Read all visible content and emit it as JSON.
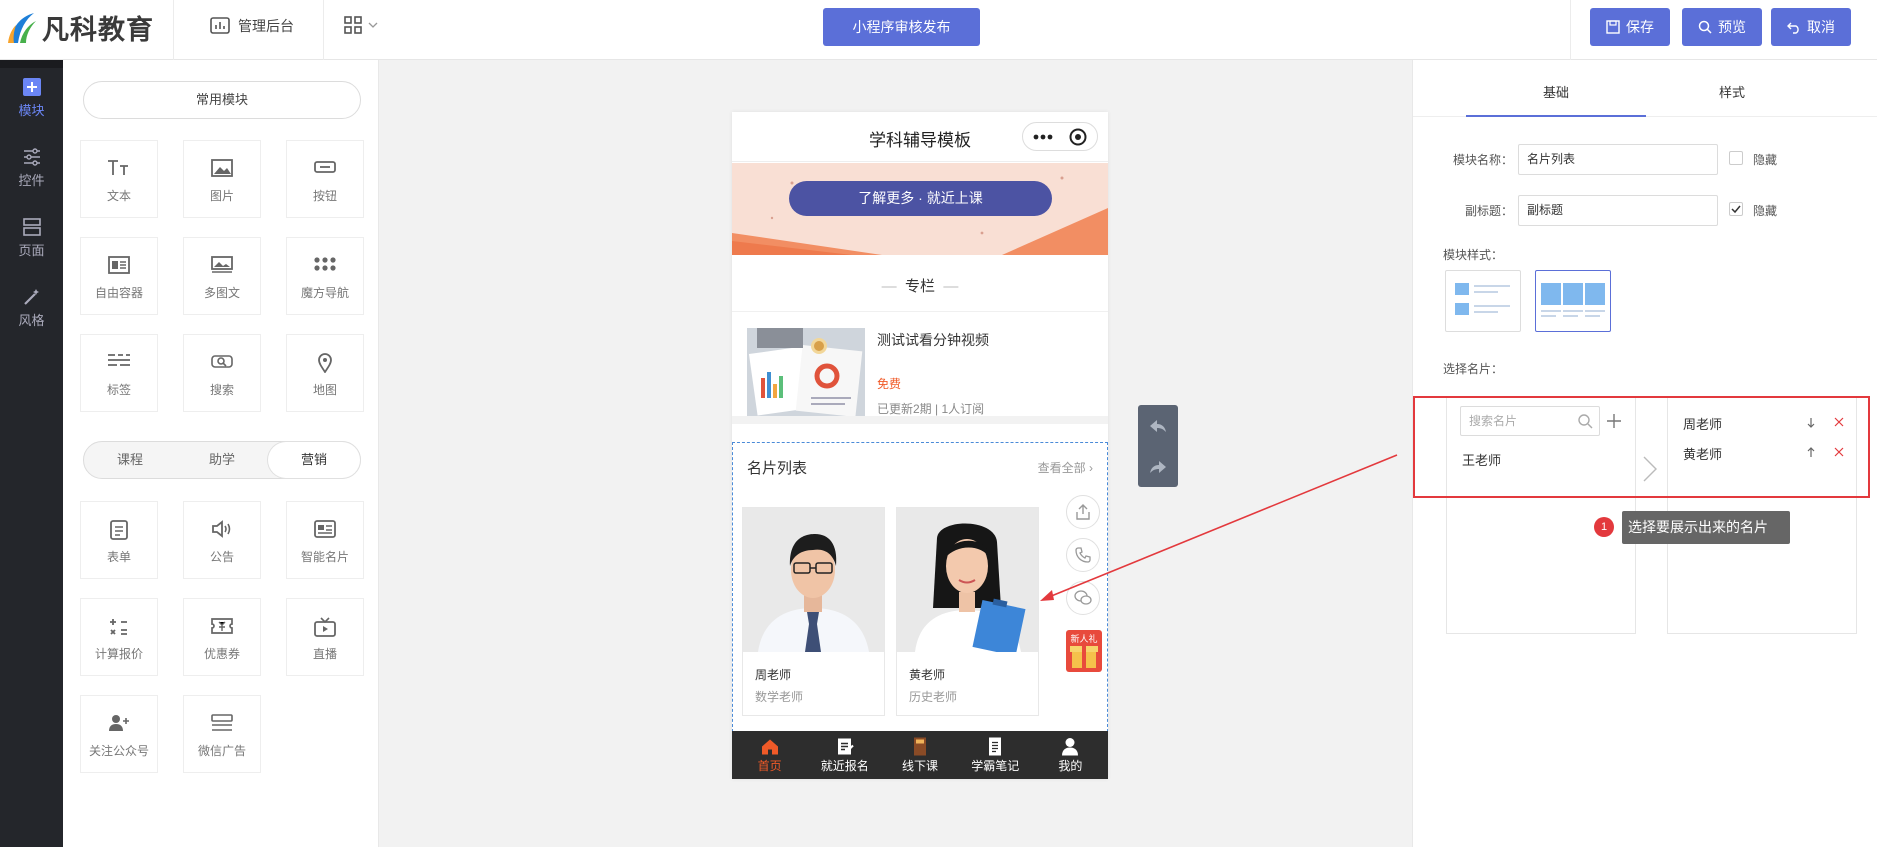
{
  "header": {
    "logo_text": "凡科教育",
    "admin_label": "管理后台",
    "publish_label": "小程序审核发布",
    "save_label": "保存",
    "preview_label": "预览",
    "cancel_label": "取消",
    "accent_color": "#5b6fd8"
  },
  "leftnav": {
    "items": [
      {
        "label": "模块",
        "icon": "plus-square-icon",
        "active": true
      },
      {
        "label": "控件",
        "icon": "sliders-icon"
      },
      {
        "label": "页面",
        "icon": "layout-icon"
      },
      {
        "label": "风格",
        "icon": "magic-wand-icon"
      }
    ]
  },
  "modules": {
    "common_title": "常用模块",
    "common": [
      {
        "label": "文本",
        "icon": "text-icon"
      },
      {
        "label": "图片",
        "icon": "image-icon"
      },
      {
        "label": "按钮",
        "icon": "button-icon"
      },
      {
        "label": "自由容器",
        "icon": "container-icon"
      },
      {
        "label": "多图文",
        "icon": "gallery-icon"
      },
      {
        "label": "魔方导航",
        "icon": "grid-dots-icon"
      },
      {
        "label": "标签",
        "icon": "tag-lines-icon"
      },
      {
        "label": "搜索",
        "icon": "search-icon"
      },
      {
        "label": "地图",
        "icon": "map-pin-icon"
      }
    ],
    "tabs": [
      {
        "label": "课程"
      },
      {
        "label": "助学"
      },
      {
        "label": "营销",
        "active": true
      }
    ],
    "marketing": [
      {
        "label": "表单",
        "icon": "form-icon"
      },
      {
        "label": "公告",
        "icon": "speaker-icon"
      },
      {
        "label": "智能名片",
        "icon": "card-icon"
      },
      {
        "label": "计算报价",
        "icon": "calculator-icon"
      },
      {
        "label": "优惠券",
        "icon": "coupon-icon"
      },
      {
        "label": "直播",
        "icon": "tv-icon"
      },
      {
        "label": "关注公众号",
        "icon": "follow-user-icon"
      },
      {
        "label": "微信广告",
        "icon": "ad-icon"
      }
    ]
  },
  "phone": {
    "title": "学科辅导模板",
    "banner_button": "了解更多 · 就近上课",
    "section_title": "专栏",
    "course": {
      "title": "测试试看分钟视频",
      "price": "免费",
      "meta": "已更新2期 | 1人订阅"
    },
    "cards": {
      "title": "名片列表",
      "more": "查看全部",
      "items": [
        {
          "name": "周老师",
          "role": "数学老师"
        },
        {
          "name": "黄老师",
          "role": "历史老师"
        }
      ],
      "gift_label": "新人礼"
    },
    "tabbar": [
      {
        "label": "首页",
        "icon": "home-icon",
        "active": true
      },
      {
        "label": "就近报名",
        "icon": "signup-icon"
      },
      {
        "label": "线下课",
        "icon": "book-icon"
      },
      {
        "label": "学霸笔记",
        "icon": "notes-icon"
      },
      {
        "label": "我的",
        "icon": "user-icon"
      }
    ]
  },
  "settings": {
    "tabs": [
      {
        "label": "基础",
        "active": true
      },
      {
        "label": "样式"
      }
    ],
    "module_name_label": "模块名称：",
    "module_name_value": "名片列表",
    "hide_label": "隐藏",
    "subtitle_label": "副标题：",
    "subtitle_value": "副标题",
    "subtitle_hidden": true,
    "module_hidden": false,
    "style_label": "模块样式：",
    "pick_label": "选择名片：",
    "search_placeholder": "搜索名片",
    "available": [
      "王老师"
    ],
    "selected": [
      "周老师",
      "黄老师"
    ],
    "tooltip_badge": "1",
    "tooltip_text": "选择要展示出来的名片"
  }
}
